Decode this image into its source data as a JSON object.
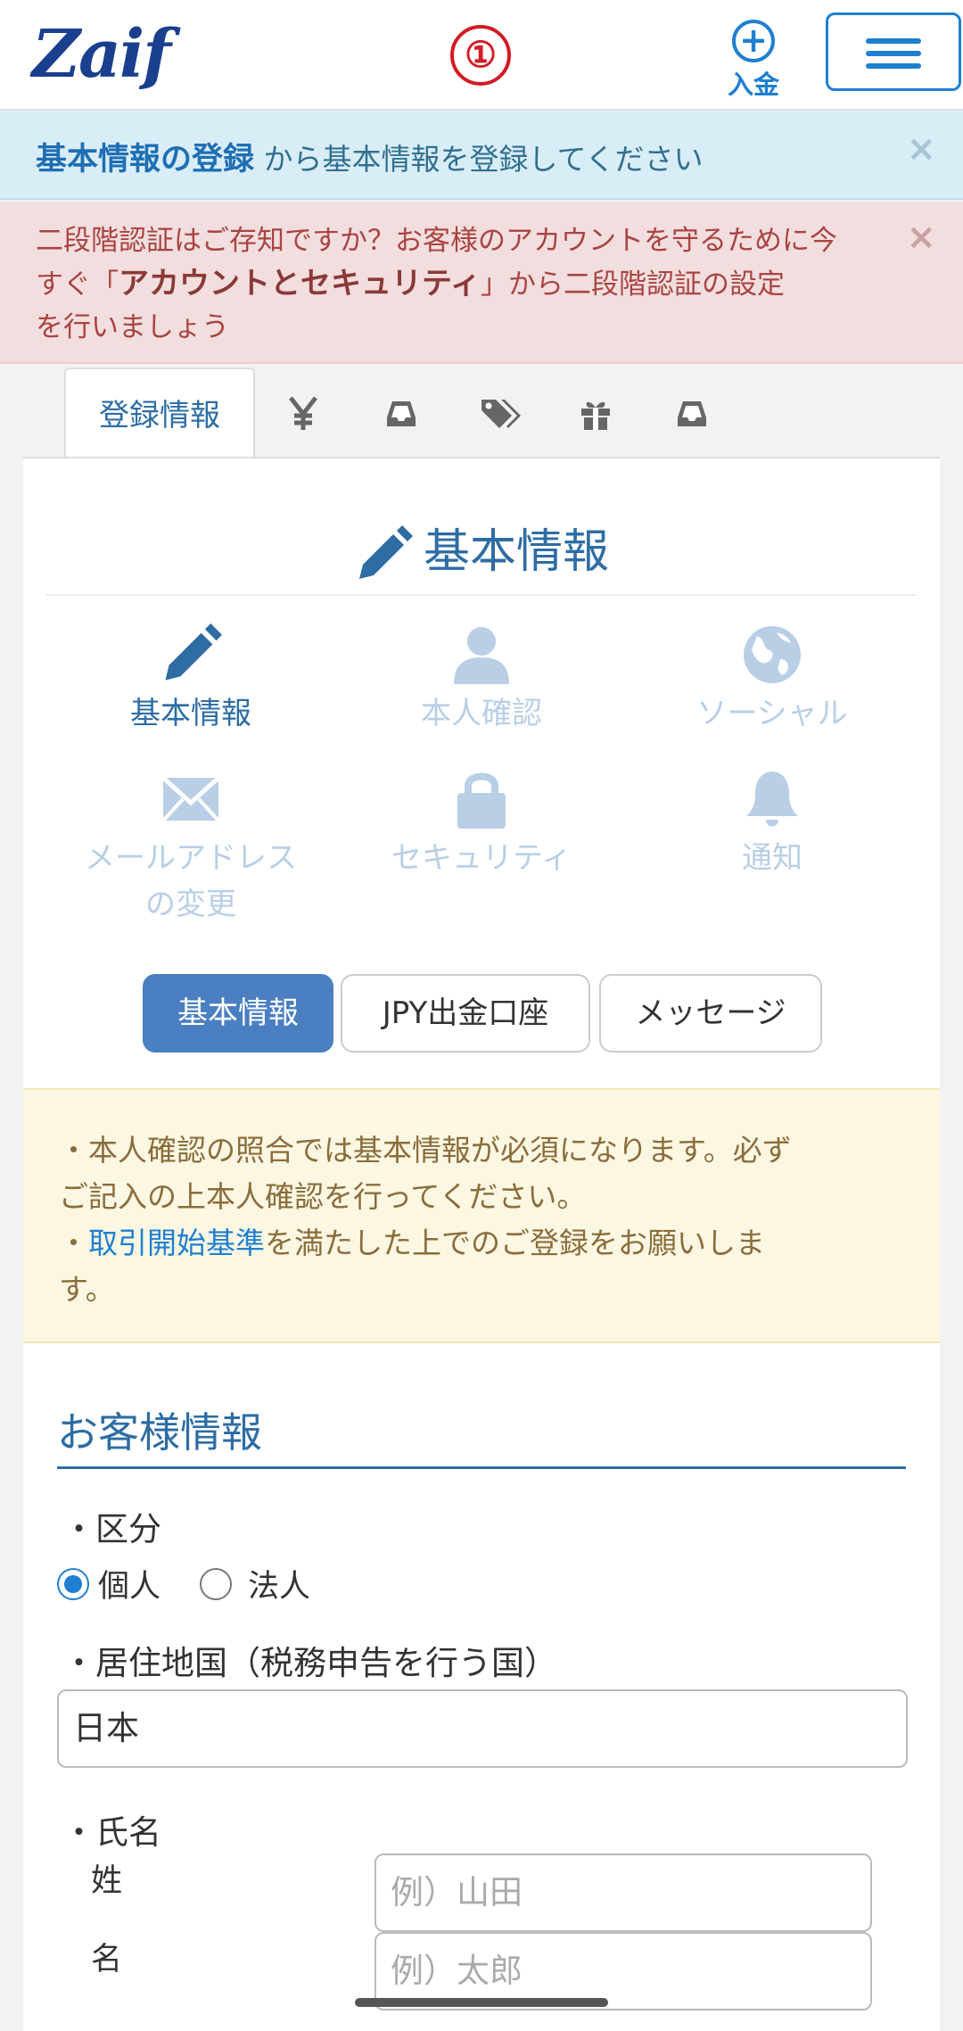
{
  "header": {
    "logo": "Zaif",
    "marker": "①",
    "deposit_label": "入金"
  },
  "alerts": {
    "info_bold": "基本情報の登録",
    "info_text": " から基本情報を登録してください",
    "danger_line1": "二段階認証はご存知ですか？お客様のアカウントを守るために今",
    "danger_line2_pre": "すぐ「",
    "danger_line2_bold": "アカウントとセキュリティ",
    "danger_line2_post": "」から二段階認証の設定",
    "danger_line3": "を行いましょう",
    "close": "×"
  },
  "tabs": {
    "active_label": "登録情報",
    "icons": [
      "yen-icon",
      "inbox-icon",
      "tags-icon",
      "gift-icon",
      "inbox-icon"
    ]
  },
  "section": {
    "title": "基本情報"
  },
  "nav": {
    "basic": "基本情報",
    "identity": "本人確認",
    "social": "ソーシャル",
    "mail_line1": "メールアドレス",
    "mail_line2": "の変更",
    "security": "セキュリティ",
    "notify": "通知"
  },
  "pills": {
    "basic": "基本情報",
    "jpy": "JPY出金口座",
    "message": "メッセージ"
  },
  "warning": {
    "line1": "・本人確認の照合では基本情報が必須になります。必ず",
    "line2": "ご記入の上本人確認を行ってください。",
    "line3_pre": "・",
    "line3_link": "取引開始基準",
    "line3_post": "を満たした上でのご登録をお願いしま",
    "line4": "す。"
  },
  "form": {
    "heading": "お客様情報",
    "category_label": "・区分",
    "option_individual": "個人",
    "option_corporate": "法人",
    "country_label": "・居住地国（税務申告を行う国）",
    "country_value": "日本",
    "name_label": "・氏名",
    "last_name_label": "姓",
    "first_name_label": "名",
    "last_name_placeholder": "例）山田",
    "first_name_placeholder": "例）太郎"
  },
  "colors": {
    "brand": "#1a3f8f",
    "accent": "#1f7fd1",
    "active_pill": "#4a7fc1",
    "info_bg": "#d9edf7",
    "danger_bg": "#f2dede",
    "warning_bg": "#fcf7e3"
  }
}
